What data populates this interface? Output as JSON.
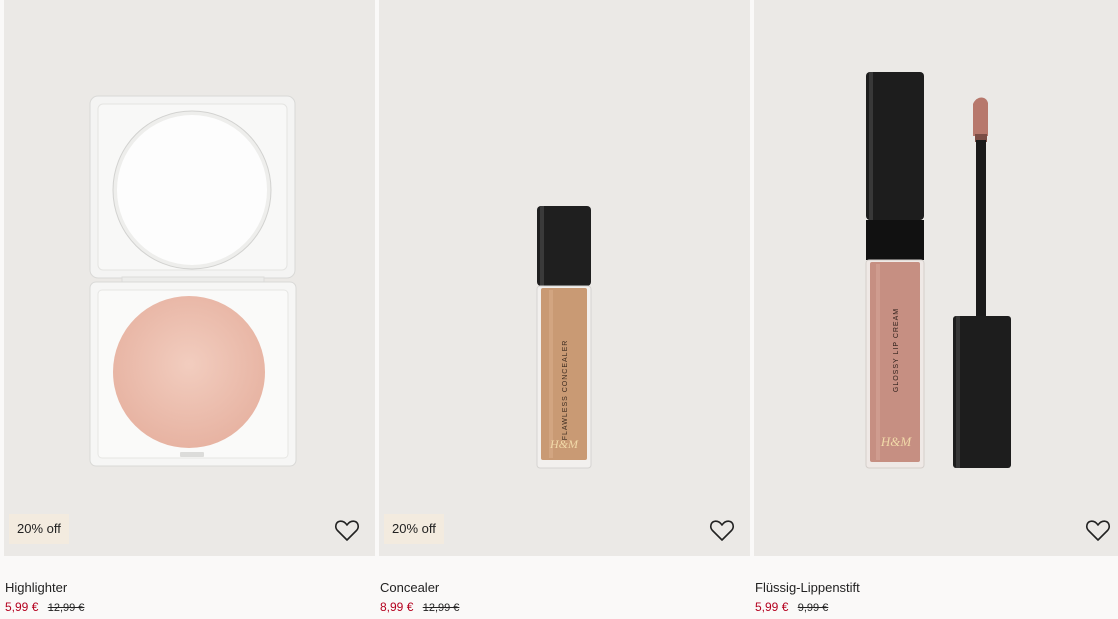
{
  "products": [
    {
      "name": "Highlighter",
      "sale_price": "5,99 €",
      "original_price": "12,99 €",
      "badge": "20% off",
      "wishlist_icon": "heart-icon"
    },
    {
      "name": "Concealer",
      "sale_price": "8,99 €",
      "original_price": "12,99 €",
      "badge": "20% off",
      "wishlist_icon": "heart-icon",
      "package_text": "FLAWLESS CONCEALER",
      "brand_text": "H&M"
    },
    {
      "name": "Flüssig-Lippenstift",
      "sale_price": "5,99 €",
      "original_price": "9,99 €",
      "wishlist_icon": "heart-icon",
      "package_text": "GLOSSY LIP CREAM",
      "brand_text": "H&M"
    }
  ],
  "colors": {
    "sale_price": "#b4001e",
    "badge_bg": "#f3ebdf",
    "image_bg": "#ebe9e6"
  }
}
